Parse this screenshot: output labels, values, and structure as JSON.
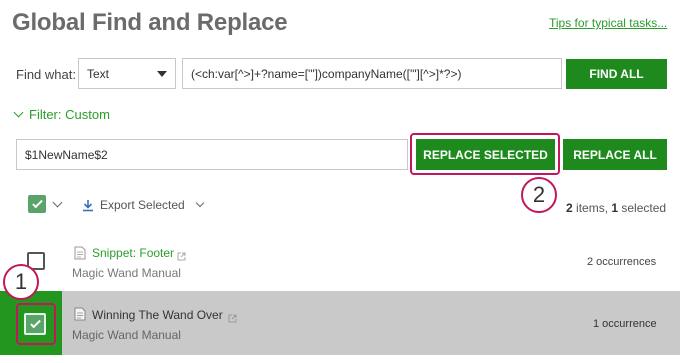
{
  "header": {
    "title": "Global Find and Replace",
    "tips_link": "Tips for typical tasks..."
  },
  "find": {
    "label": "Find what:",
    "type_selected": "Text",
    "query_value": "(<ch:var[^>]+?name=['\"])companyName(['\"][^>]*?>)",
    "find_all_label": "FIND ALL"
  },
  "filter": {
    "label": "Filter: Custom"
  },
  "replace": {
    "value": "$1NewName$2",
    "replace_selected_label": "REPLACE SELECTED",
    "replace_all_label": "REPLACE ALL"
  },
  "toolbar": {
    "export_label": "Export Selected",
    "count_items": "2",
    "count_items_text": " items, ",
    "count_selected": "1",
    "count_selected_text": " selected"
  },
  "callouts": {
    "one": "1",
    "two": "2"
  },
  "results": [
    {
      "name": "Snippet: Footer",
      "project": "Magic Wand Manual",
      "occurrences": "2 occurrences",
      "selected": false
    },
    {
      "name": "Winning The Wand Over",
      "project": "Magic Wand Manual",
      "occurrences": "1 occurrence",
      "selected": true
    }
  ],
  "colors": {
    "accent_green": "#1e8a1e",
    "callout_magenta": "#c2185b",
    "selected_row_bg": "#c9c9c9"
  },
  "icons": [
    "chevron-down-icon",
    "download-icon",
    "document-icon",
    "external-link-icon",
    "checkmark-icon"
  ]
}
